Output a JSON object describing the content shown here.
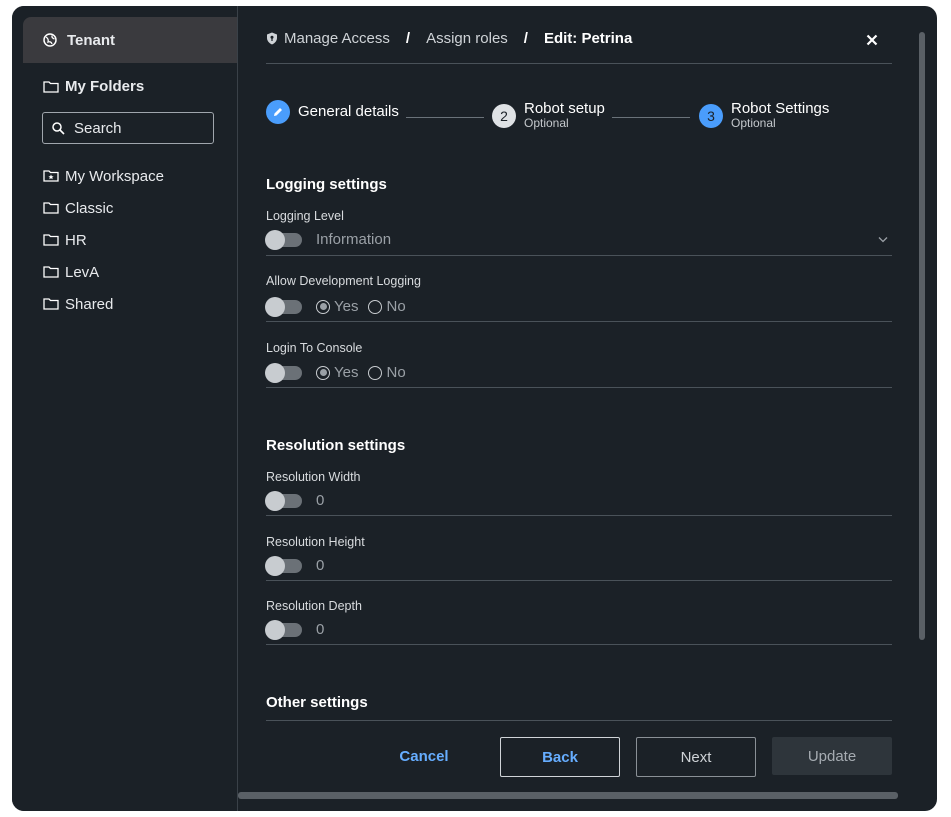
{
  "sidebar": {
    "tenant_label": "Tenant",
    "my_folders_label": "My Folders",
    "search_placeholder": "Search",
    "folders": [
      {
        "label": "My Workspace",
        "icon": "workspace-folder-icon"
      },
      {
        "label": "Classic",
        "icon": "folder-icon"
      },
      {
        "label": "HR",
        "icon": "folder-icon"
      },
      {
        "label": "LevA",
        "icon": "folder-icon"
      },
      {
        "label": "Shared",
        "icon": "folder-icon"
      }
    ]
  },
  "breadcrumb": {
    "items": [
      "Manage Access",
      "Assign roles"
    ],
    "separator": "/",
    "current": "Edit: Petrina"
  },
  "stepper": {
    "steps": [
      {
        "title": "General details",
        "subtitle": "",
        "state": "completed"
      },
      {
        "number": "2",
        "title": "Robot setup",
        "subtitle": "Optional",
        "state": "inactive"
      },
      {
        "number": "3",
        "title": "Robot Settings",
        "subtitle": "Optional",
        "state": "active"
      }
    ]
  },
  "logging": {
    "title": "Logging settings",
    "level_label": "Logging Level",
    "level_value": "Information",
    "dev_logging_label": "Allow Development Logging",
    "console_label": "Login To Console",
    "yes": "Yes",
    "no": "No"
  },
  "resolution": {
    "title": "Resolution settings",
    "width_label": "Resolution Width",
    "width_value": "0",
    "height_label": "Resolution Height",
    "height_value": "0",
    "depth_label": "Resolution Depth",
    "depth_value": "0"
  },
  "other": {
    "title": "Other settings"
  },
  "footer": {
    "cancel": "Cancel",
    "back": "Back",
    "next": "Next",
    "update": "Update"
  },
  "colors": {
    "background": "#1b2127",
    "accent": "#66adff",
    "step_active": "#4a9dfc"
  }
}
